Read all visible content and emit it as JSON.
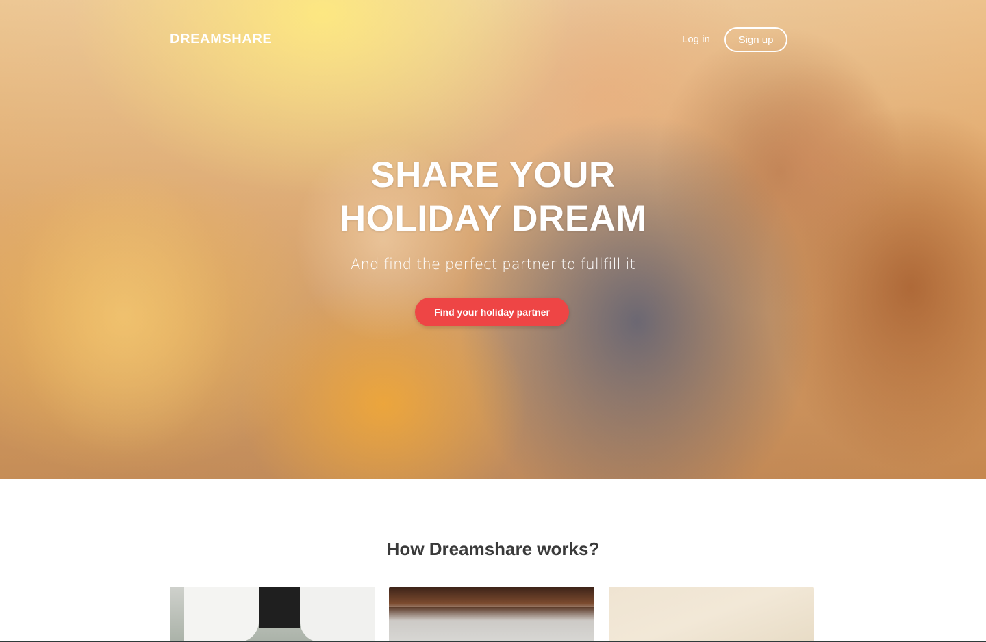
{
  "nav": {
    "logo": "DREAMSHARE",
    "login_label": "Log in",
    "signup_label": "Sign up"
  },
  "hero": {
    "title_line1": "SHARE YOUR",
    "title_line2": "HOLIDAY DREAM",
    "subtitle": "And find the perfect partner to fullfill it",
    "cta_label": "Find your holiday partner",
    "background": "photo-of-friends-laughing"
  },
  "how_it_works": {
    "title": "How Dreamshare works?"
  },
  "colors": {
    "accent": "#ee4545",
    "text_dark": "#3a3a3a",
    "white": "#ffffff"
  }
}
